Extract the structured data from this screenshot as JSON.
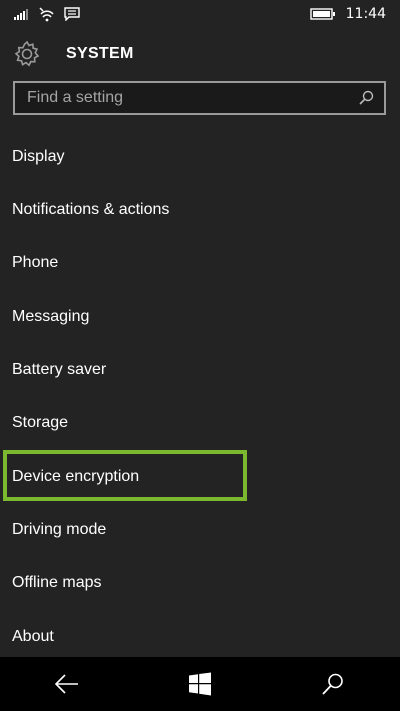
{
  "status_bar": {
    "time": "11:44",
    "icons": [
      "signal-icon",
      "wifi-icon",
      "message-icon",
      "battery-icon"
    ]
  },
  "header": {
    "title": "SYSTEM",
    "icon": "gear-icon"
  },
  "search": {
    "placeholder": "Find a setting",
    "icon": "search-icon"
  },
  "settings": {
    "items": [
      {
        "label": "Display"
      },
      {
        "label": "Notifications & actions"
      },
      {
        "label": "Phone"
      },
      {
        "label": "Messaging"
      },
      {
        "label": "Battery saver"
      },
      {
        "label": "Storage"
      },
      {
        "label": "Device encryption"
      },
      {
        "label": "Driving mode"
      },
      {
        "label": "Offline maps"
      },
      {
        "label": "About"
      }
    ],
    "highlight_color": "#7cb82f"
  },
  "nav_bar": {
    "buttons": [
      "back-arrow-icon",
      "windows-start-icon",
      "search-icon"
    ]
  }
}
